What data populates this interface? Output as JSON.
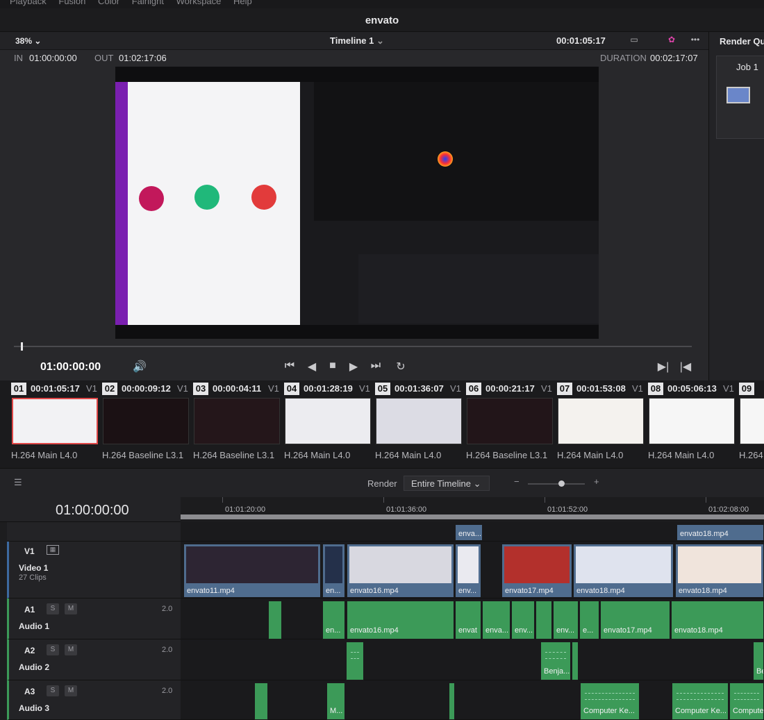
{
  "menu": [
    "Playback",
    "Fusion",
    "Color",
    "Fairlight",
    "Workspace",
    "Help"
  ],
  "app_title": "envato",
  "viewer": {
    "zoom": "38%",
    "timeline_name": "Timeline 1",
    "timecode": "00:01:05:17",
    "in_label": "IN",
    "in_value": "01:00:00:00",
    "out_label": "OUT",
    "out_value": "01:02:17:06",
    "duration_label": "DURATION",
    "duration_value": "00:02:17:07",
    "playhead_timecode": "01:00:00:00"
  },
  "render_queue": {
    "title": "Render Qu",
    "job": "Job 1"
  },
  "clips": [
    {
      "num": "01",
      "tc": "00:01:05:17",
      "v": "V1",
      "codec": "H.264 Main L4.0"
    },
    {
      "num": "02",
      "tc": "00:00:09:12",
      "v": "V1",
      "codec": "H.264 Baseline L3.1"
    },
    {
      "num": "03",
      "tc": "00:00:04:11",
      "v": "V1",
      "codec": "H.264 Baseline L3.1"
    },
    {
      "num": "04",
      "tc": "00:01:28:19",
      "v": "V1",
      "codec": "H.264 Main L4.0"
    },
    {
      "num": "05",
      "tc": "00:01:36:07",
      "v": "V1",
      "codec": "H.264 Main L4.0"
    },
    {
      "num": "06",
      "tc": "00:00:21:17",
      "v": "V1",
      "codec": "H.264 Baseline L3.1"
    },
    {
      "num": "07",
      "tc": "00:01:53:08",
      "v": "V1",
      "codec": "H.264 Main L4.0"
    },
    {
      "num": "08",
      "tc": "00:05:06:13",
      "v": "V1",
      "codec": "H.264 Main L4.0"
    },
    {
      "num": "09",
      "tc": "",
      "v": "",
      "codec": "H.264"
    }
  ],
  "render_bar": {
    "label": "Render",
    "option": "Entire Timeline"
  },
  "timeline": {
    "timecode": "01:00:00:00",
    "ruler": [
      "01:01:20:00",
      "01:01:36:00",
      "01:01:52:00",
      "01:02:08:00"
    ],
    "tracks": {
      "v1": {
        "id": "V1",
        "name": "Video 1",
        "sub": "27 Clips"
      },
      "a1": {
        "id": "A1",
        "name": "Audio 1",
        "level": "2.0"
      },
      "a2": {
        "id": "A2",
        "name": "Audio 2",
        "level": "2.0"
      },
      "a3": {
        "id": "A3",
        "name": "Audio 3",
        "level": "2.0"
      },
      "solo": "S",
      "mute": "M"
    },
    "v2_clips": [
      "enva...",
      "envato18.mp4"
    ],
    "v1_clips": [
      "envato11.mp4",
      "en...",
      "envato16.mp4",
      "env...",
      "envato17.mp4",
      "envato18.mp4",
      "envato18.mp4"
    ],
    "a1_clips": [
      "en...",
      "envato16.mp4",
      "envat",
      "enva...",
      "env...",
      "env...",
      "e...",
      "envato17.mp4",
      "envato18.mp4"
    ],
    "a2_clips": [
      "Benja...",
      "Be"
    ],
    "a3_clips": [
      "M...",
      "Computer Ke...",
      "Computer Ke...",
      "Compute"
    ]
  }
}
